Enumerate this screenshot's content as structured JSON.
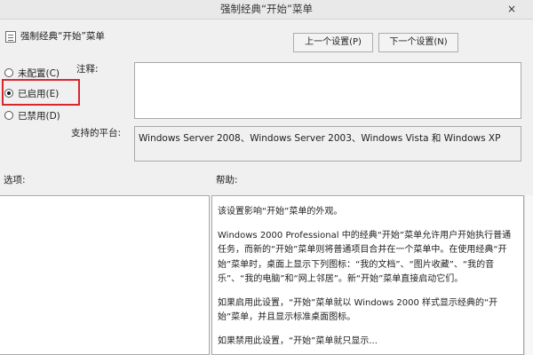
{
  "window": {
    "title": "强制经典“开始”菜单",
    "close_glyph": "×"
  },
  "header": {
    "policy_name": "强制经典“开始”菜单",
    "prev_button": "上一个设置(P)",
    "next_button": "下一个设置(N)"
  },
  "state": {
    "options": [
      {
        "label": "未配置(C)",
        "checked": false
      },
      {
        "label": "已启用(E)",
        "checked": true
      },
      {
        "label": "已禁用(D)",
        "checked": false
      }
    ],
    "highlight_color": "#d9272e"
  },
  "comment": {
    "label": "注释:",
    "value": ""
  },
  "platform": {
    "label": "支持的平台:",
    "value": "Windows Server 2008、Windows Server 2003、Windows Vista 和 Windows XP"
  },
  "options_pane": {
    "label": "选项:"
  },
  "help_pane": {
    "label": "帮助:",
    "paragraphs": [
      "该设置影响“开始”菜单的外观。",
      "Windows 2000 Professional 中的经典“开始”菜单允许用户开始执行普通任务，而新的“开始”菜单则将普通项目合并在一个菜单中。在使用经典“开始”菜单时，桌面上显示下列图标：“我的文档”、“图片收藏”、“我的音乐”、“我的电脑”和“网上邻居”。新“开始”菜单直接启动它们。",
      "如果启用此设置，“开始”菜单就以 Windows 2000 样式显示经典的“开始”菜单，并且显示标准桌面图标。",
      "如果禁用此设置，“开始”菜单就只显示..."
    ]
  }
}
